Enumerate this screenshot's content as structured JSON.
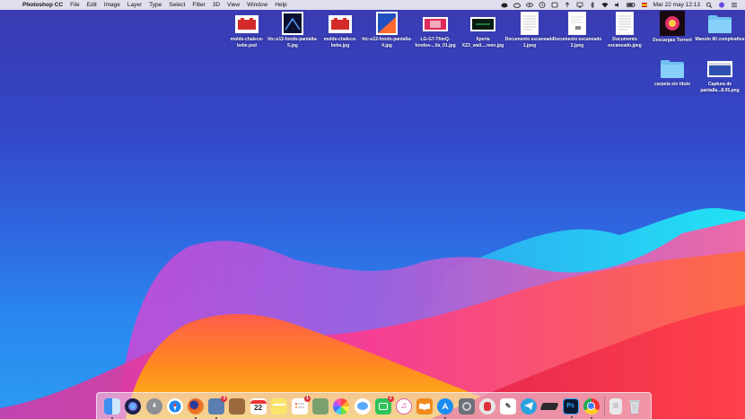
{
  "menubar": {
    "app_name": "Photoshop CC",
    "menus": [
      "File",
      "Edit",
      "Image",
      "Layer",
      "Type",
      "Select",
      "Filter",
      "3D",
      "View",
      "Window",
      "Help"
    ],
    "datetime": "Mar 22 may  12:13"
  },
  "desktop_icons": [
    {
      "label": "molde-chaleco-bebe.psd",
      "kind": "psd"
    },
    {
      "label": "htc-u12-fondo-pantalla-5.jpg",
      "kind": "dark-image"
    },
    {
      "label": "molde-chaleco-bebe.jpg",
      "kind": "red-image"
    },
    {
      "label": "htc-u12-fondo-pantalla-4.jpg",
      "kind": "wallpaper-image"
    },
    {
      "label": "LG-G7-ThinQ-fondos-...lla_01.jpg",
      "kind": "wide-image"
    },
    {
      "label": "Xperia XZ3_wall....reen.jpg",
      "kind": "dark-wide-image"
    },
    {
      "label": "Documento escaneado 1.jpeg",
      "kind": "document"
    },
    {
      "label": "Documento escaneado 2.jpeg",
      "kind": "document"
    },
    {
      "label": "Documento escaneado.jpeg",
      "kind": "document"
    },
    {
      "label": "Descargas Torrent",
      "kind": "torrent-image"
    },
    {
      "label": "Manolo 80 cumpleaños",
      "kind": "folder"
    },
    {
      "label": "carpeta sin título",
      "kind": "folder"
    },
    {
      "label": "Captura de pantalla...8.05.png",
      "kind": "screenshot-image"
    }
  ],
  "dock": {
    "apps": [
      {
        "name": "finder-icon",
        "color": "#3c8ef0",
        "running": true
      },
      {
        "name": "siri-icon",
        "color": "#1b1f4a",
        "running": false
      },
      {
        "name": "launchpad-icon",
        "color": "#8c8f96",
        "running": false
      },
      {
        "name": "safari-icon",
        "color": "#1b86f0",
        "running": false
      },
      {
        "name": "firefox-icon",
        "color": "#e8602a",
        "running": true
      },
      {
        "name": "preview-icon",
        "color": "#5b7fb0",
        "running": true,
        "badge": "3"
      },
      {
        "name": "notebook-icon",
        "color": "#9a6a3e",
        "running": false
      },
      {
        "name": "calendar-icon",
        "color": "#ffffff",
        "running": false,
        "text": "22"
      },
      {
        "name": "notes-icon",
        "color": "#fbe46a",
        "running": false
      },
      {
        "name": "reminders-icon",
        "color": "#ffffff",
        "running": false,
        "badge": "1"
      },
      {
        "name": "image-capture-icon",
        "color": "#7aa070",
        "running": false
      },
      {
        "name": "photos-icon",
        "color": "#f2f2f2",
        "running": false
      },
      {
        "name": "messages-icon",
        "color": "#5aa8f8",
        "running": false
      },
      {
        "name": "facetime-icon",
        "color": "#2fc45a",
        "running": false,
        "badge": "2"
      },
      {
        "name": "itunes-icon",
        "color": "#ffffff",
        "running": false
      },
      {
        "name": "books-icon",
        "color": "#f28a1d",
        "running": false
      },
      {
        "name": "app-store-icon",
        "color": "#1a8cf2",
        "running": true
      },
      {
        "name": "system-preferences-icon",
        "color": "#6b6f78",
        "running": false
      },
      {
        "name": "flashlight-icon",
        "color": "#e6e6e6",
        "running": false
      },
      {
        "name": "text-editor-icon",
        "color": "#ffffff",
        "running": false
      },
      {
        "name": "telegram-icon",
        "color": "#2aa2e0",
        "running": false
      },
      {
        "name": "external-drive-icon",
        "color": "#2a2a2e",
        "running": false
      },
      {
        "name": "photoshop-icon",
        "color": "#0a1a32",
        "running": true,
        "text": "Ps"
      },
      {
        "name": "chrome-icon",
        "color": "#ffffff",
        "running": true
      }
    ],
    "trailing": [
      {
        "name": "downloads-stack-icon",
        "color": "#e9e9ec"
      },
      {
        "name": "trash-icon",
        "color": "#d8dbe0"
      }
    ]
  }
}
